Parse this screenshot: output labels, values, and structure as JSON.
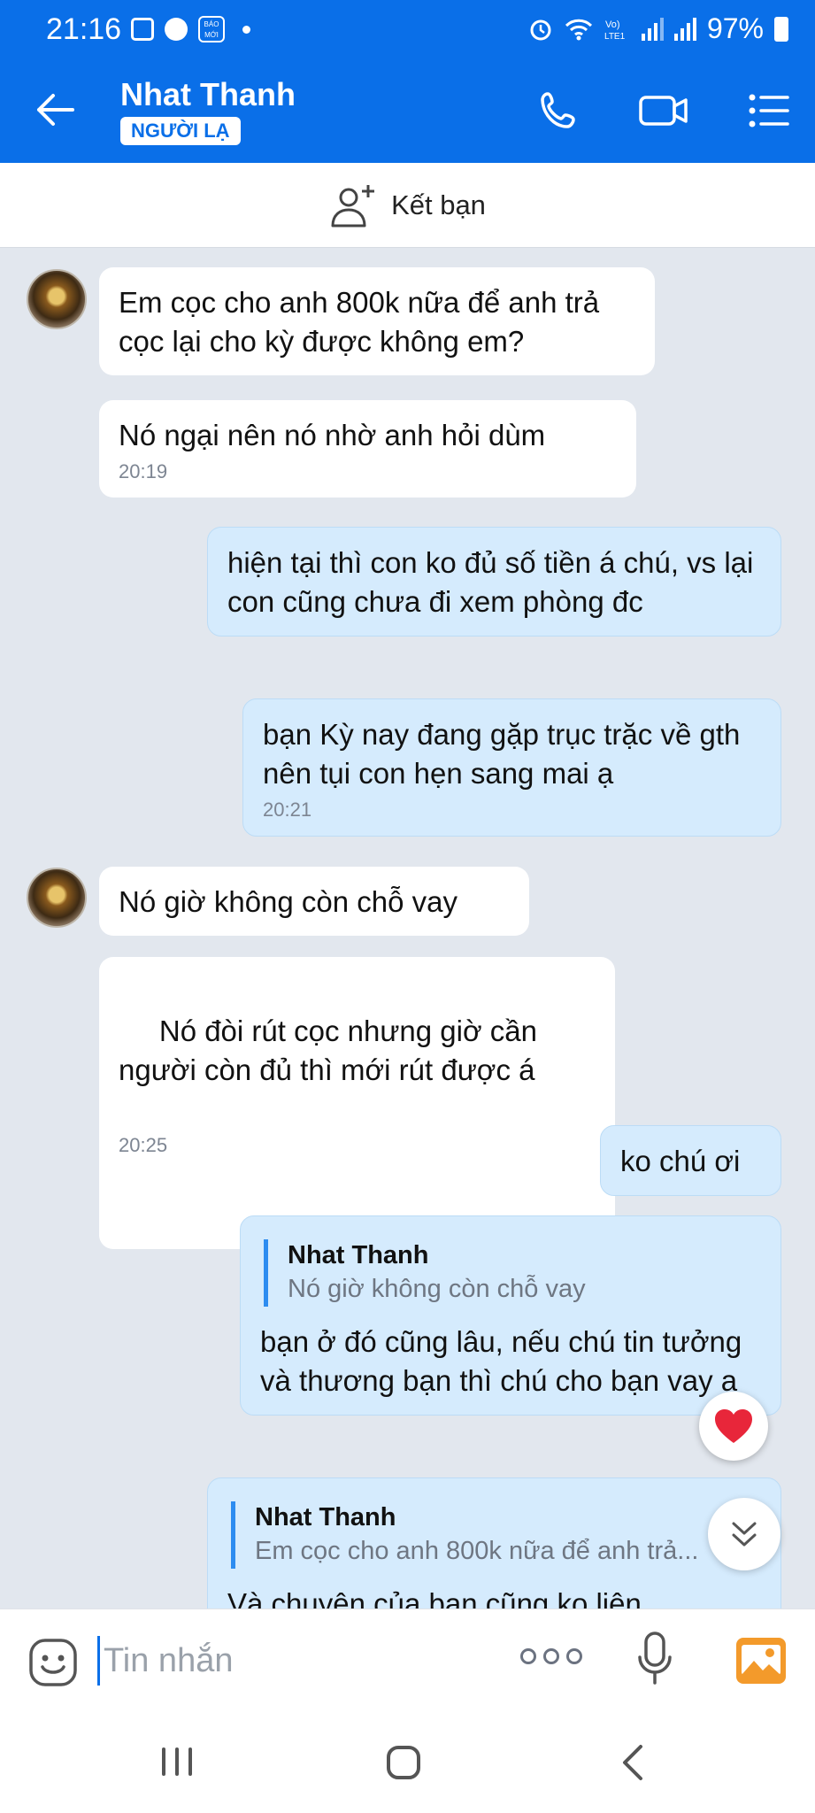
{
  "status_bar": {
    "time": "21:16",
    "baomoi_label": "BÁO MỚI",
    "battery": "97%"
  },
  "header": {
    "title": "Nhat Thanh",
    "badge": "NGƯỜI LẠ"
  },
  "friend_bar": {
    "label": "Kết bạn"
  },
  "messages": [
    {
      "text": "Em cọc cho anh 800k nữa để anh trả cọc lại cho kỳ được không em?"
    },
    {
      "text": "Nó ngại nên nó nhờ anh hỏi dùm",
      "time": "20:19"
    },
    {
      "text": "hiện tại thì con ko đủ số tiền á chú, vs lại con cũng chưa đi xem phòng đc"
    },
    {
      "text": "bạn Kỳ nay đang gặp trục trặc về gth nên tụi con hẹn sang mai ạ",
      "time": "20:21"
    },
    {
      "text": "Nó giờ không còn chỗ vay"
    },
    {
      "text": " Nó đòi rút cọc nhưng giờ cần người còn đủ thì mới rút được á",
      "time": "20:25"
    },
    {
      "text": "ko chú ơi"
    },
    {
      "quote_author": "Nhat Thanh",
      "quote_text": "Nó giờ không còn chỗ vay",
      "text": "bạn ở đó cũng lâu, nếu chú tin tưởng và thương bạn thì chú cho bạn vay ạ"
    },
    {
      "quote_author": "Nhat Thanh",
      "quote_text": "Em cọc cho anh 800k nữa để anh trả...",
      "text": "Và chuyện của bạn cũng ko liên"
    }
  ],
  "input": {
    "placeholder": "Tin nhắn"
  },
  "colors": {
    "brand": "#0a6fe8",
    "outgoing_bubble": "#d5ebfd",
    "incoming_bubble": "#ffffff",
    "chat_bg": "#e2e7ee"
  }
}
